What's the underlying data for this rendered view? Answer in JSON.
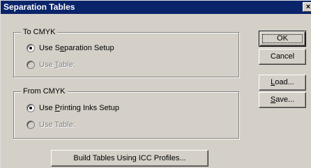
{
  "window": {
    "title": "Separation Tables"
  },
  "to_cmyk": {
    "label": "To CMYK",
    "option1": {
      "pre": "Use S",
      "key": "e",
      "post": "paration Setup"
    },
    "option2": {
      "pre": "Use ",
      "key": "T",
      "post": "able:"
    }
  },
  "from_cmyk": {
    "label": "From CMYK",
    "option1": {
      "pre": "Use ",
      "key": "P",
      "post": "rinting Inks Setup"
    },
    "option2": {
      "pre": "Use Table:"
    }
  },
  "buttons": {
    "ok": "OK",
    "cancel": "Cancel",
    "load": {
      "key": "L",
      "post": "oad..."
    },
    "save": {
      "key": "S",
      "post": "ave..."
    },
    "build": "Build Tables Using ICC Profiles..."
  },
  "icons": {
    "close": "×"
  }
}
